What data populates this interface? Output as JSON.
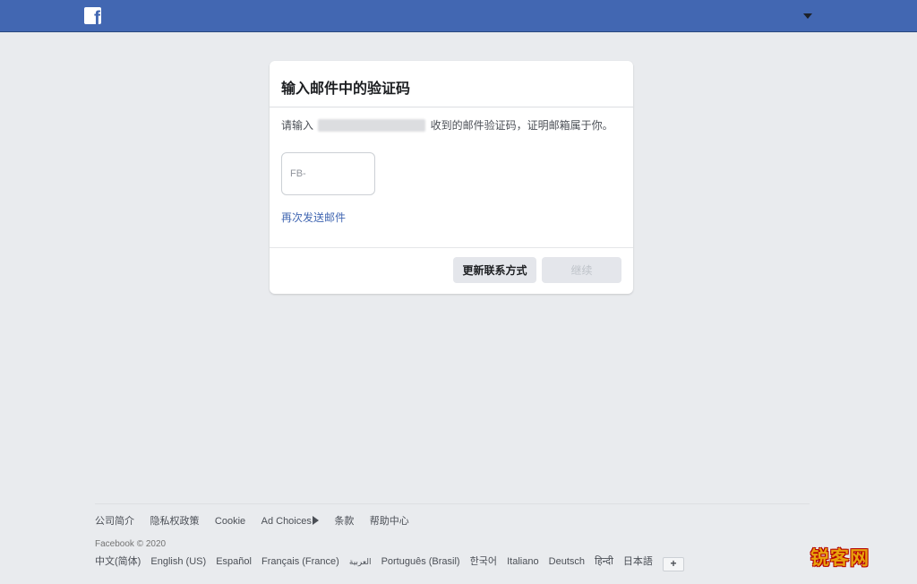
{
  "topbar": {
    "logo": "f",
    "menu_icon": "caret-down-icon",
    "color": "#4267b2"
  },
  "card": {
    "title": "输入邮件中的验证码",
    "desc_prefix": "请输入 ",
    "desc_suffix": " 收到的邮件验证码，证明邮箱属于你。",
    "code_placeholder": "FB-",
    "code_value": "",
    "resend_link": "再次发送邮件",
    "update_button": "更新联系方式",
    "continue_button": "继续"
  },
  "footer": {
    "links": [
      "公司简介",
      "隐私权政策",
      "Cookie",
      "Ad Choices",
      "条款",
      "帮助中心"
    ],
    "copyright": "Facebook © 2020",
    "current_language": "中文(简体)",
    "languages": [
      "English (US)",
      "Español",
      "Français (France)",
      "العربية",
      "Português (Brasil)",
      "한국어",
      "Italiano",
      "Deutsch",
      "हिन्दी",
      "日本語"
    ],
    "add_language": "+"
  },
  "watermark": "锐客网",
  "colors": {
    "accent": "#4267b2",
    "background": "#e9ebee"
  }
}
